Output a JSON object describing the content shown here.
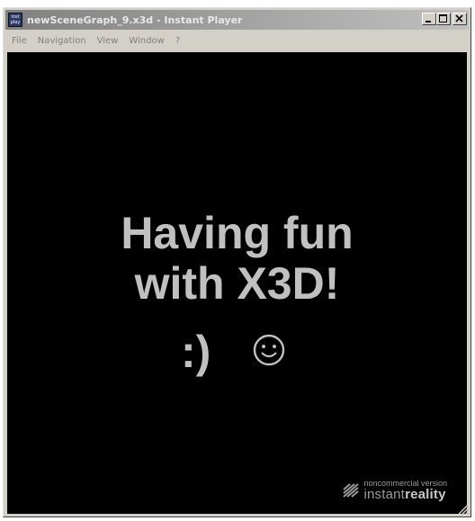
{
  "window": {
    "title": "newSceneGraph_9.x3d - Instant Player",
    "icon": "instant-player-app-icon",
    "icon_text": "inst play"
  },
  "caption_buttons": {
    "minimize_icon": "minimize-icon",
    "maximize_icon": "maximize-icon",
    "close_icon": "close-icon"
  },
  "menubar": {
    "items": [
      "File",
      "Navigation",
      "View",
      "Window",
      "?"
    ]
  },
  "scene": {
    "line1": "Having fun",
    "line2": "with X3D!",
    "smiley_text": ":)",
    "smiley_icon": "smiley-face-icon",
    "text_color": "#c0c0c0",
    "background_color": "#000000"
  },
  "watermark": {
    "small_text": "noncommercial version",
    "brand_light": "instant",
    "brand_bold": "reality"
  },
  "colors": {
    "titlebar_inactive": "#a0a0a0",
    "window_face": "#d4d0c8",
    "menu_text_disabled": "#808080"
  }
}
